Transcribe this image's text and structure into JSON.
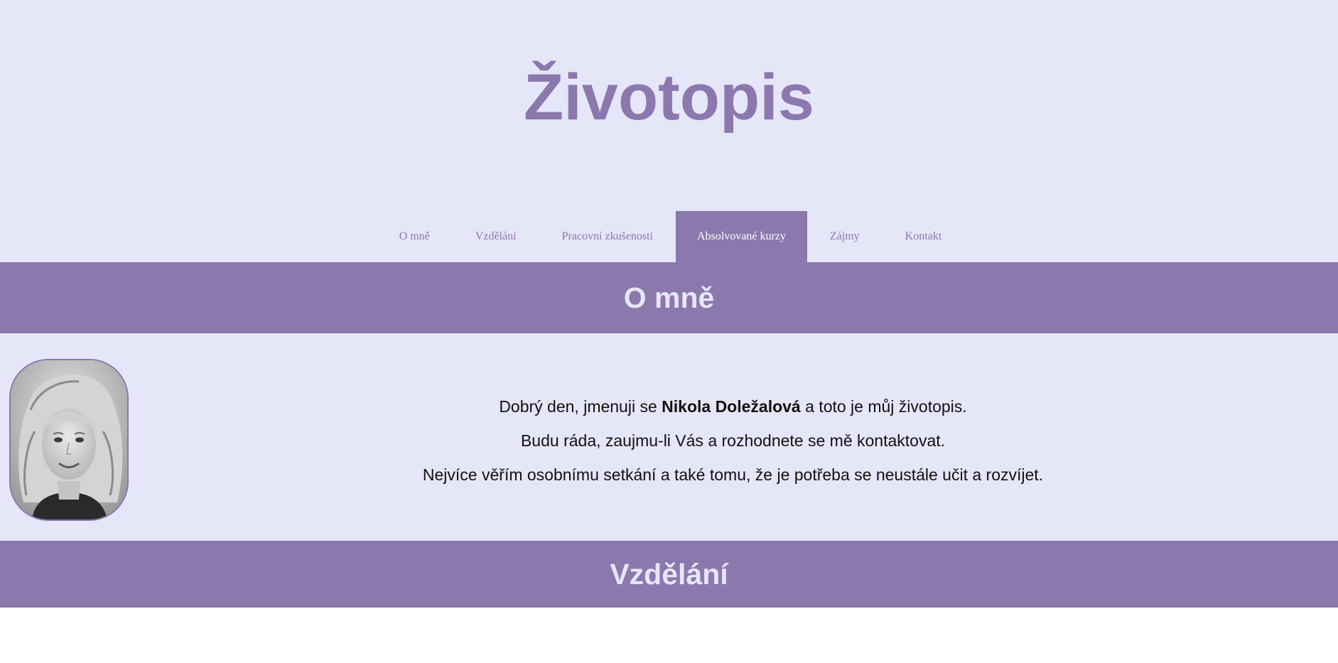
{
  "header": {
    "title": "Životopis"
  },
  "nav": {
    "items": [
      {
        "label": "O mně"
      },
      {
        "label": "Vzdělání"
      },
      {
        "label": "Pracovní zkušenosti"
      },
      {
        "label": "Absolvované kurzy",
        "active": true
      },
      {
        "label": "Zájmy"
      },
      {
        "label": "Kontakt"
      }
    ]
  },
  "about": {
    "title": "O mně",
    "line1_before": "Dobrý den, jmenuji se ",
    "name": "Nikola Doležalová",
    "line1_after": " a toto je můj životopis.",
    "line2": "Budu ráda, zaujmu-li Vás a rozhodnete se mě kontaktovat.",
    "line3": "Nejvíce věřím osobnímu setkání a také tomu, že je potřeba se neustále učit a rozvíjet."
  },
  "education": {
    "title": "Vzdělání"
  },
  "colors": {
    "background_light": "#e6e6f9",
    "accent": "#8b78ad",
    "text": "#111111"
  }
}
